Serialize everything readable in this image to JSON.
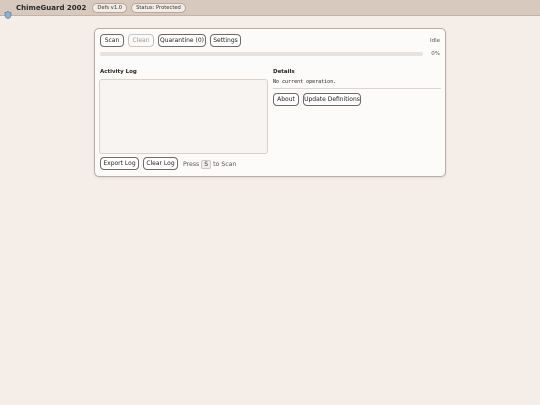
{
  "appbar": {
    "title": "ChimeGuard 2002",
    "defs_badge": "Defs v1.0",
    "status_badge": "Status: Protected"
  },
  "toolbar": {
    "scan_label": "Scan",
    "clean_label": "Clean",
    "quarantine_label": "Quarantine (0)",
    "settings_label": "Settings",
    "status_text": "Idle"
  },
  "progress": {
    "value": 0,
    "label": "0%"
  },
  "log": {
    "title": "Activity Log",
    "export_label": "Export Log",
    "clear_label": "Clear Log",
    "hint_prefix": "Press",
    "hint_key": "S",
    "hint_suffix": "to Scan"
  },
  "details": {
    "title": "Details",
    "text": "No current operation.",
    "about_label": "About",
    "update_label": "Update Definitions"
  },
  "colors": {
    "background": "#f5ede8",
    "appbar": "#d7c9be",
    "panel": "#fdfbf9"
  },
  "icons": {
    "app": "shield-icon"
  }
}
